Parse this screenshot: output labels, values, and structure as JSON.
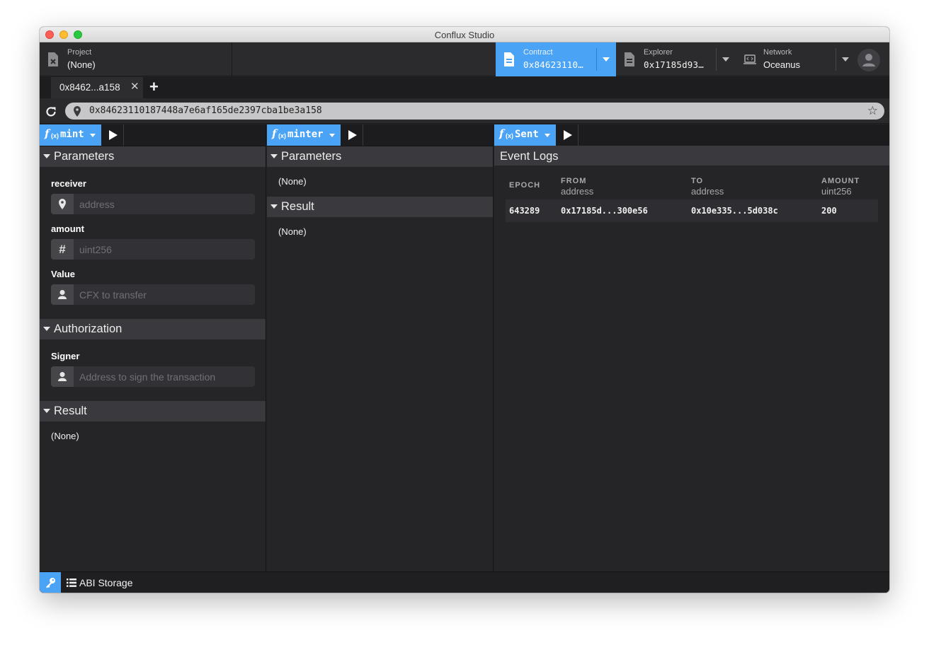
{
  "window": {
    "title": "Conflux Studio"
  },
  "header": {
    "project": {
      "label": "Project",
      "value": "(None)"
    },
    "contract": {
      "label": "Contract",
      "value": "0x84623110…"
    },
    "explorer": {
      "label": "Explorer",
      "value": "0x17185d93…"
    },
    "network": {
      "label": "Network",
      "value": "Oceanus"
    }
  },
  "tabs": [
    {
      "label": "0x8462...a158",
      "close": "✕"
    }
  ],
  "tab_add": "+",
  "address": {
    "url": "0x84623110187448a7e6af165de2397cba1be3a158"
  },
  "panels": {
    "write": {
      "function_name": "mint",
      "parameters_title": "Parameters",
      "fields": [
        {
          "label": "receiver",
          "placeholder": "address",
          "icon": "location-pin-icon"
        },
        {
          "label": "amount",
          "placeholder": "uint256",
          "icon": "hash-icon"
        },
        {
          "label": "Value",
          "placeholder": "CFX to transfer",
          "icon": "user-icon"
        }
      ],
      "authorization_title": "Authorization",
      "signer": {
        "label": "Signer",
        "placeholder": "Address to sign the transaction",
        "icon": "user-icon"
      },
      "result_title": "Result",
      "result_value": "(None)"
    },
    "read": {
      "function_name": "minter",
      "parameters_title": "Parameters",
      "parameters_value": "(None)",
      "result_title": "Result",
      "result_value": "(None)"
    },
    "events": {
      "event_name": "Sent",
      "title": "Event Logs",
      "columns": [
        {
          "name": "EPOCH",
          "type": ""
        },
        {
          "name": "FROM",
          "type": "address"
        },
        {
          "name": "TO",
          "type": "address"
        },
        {
          "name": "AMOUNT",
          "type": "uint256"
        }
      ],
      "rows": [
        {
          "epoch": "643289",
          "from": "0x17185d...300e56",
          "to": "0x10e335...5d038c",
          "amount": "200"
        }
      ]
    }
  },
  "statusbar": {
    "abi_label": "ABI Storage"
  },
  "colors": {
    "accent": "#4aa3f5",
    "background": "#252528",
    "section": "#3a3a3e"
  }
}
